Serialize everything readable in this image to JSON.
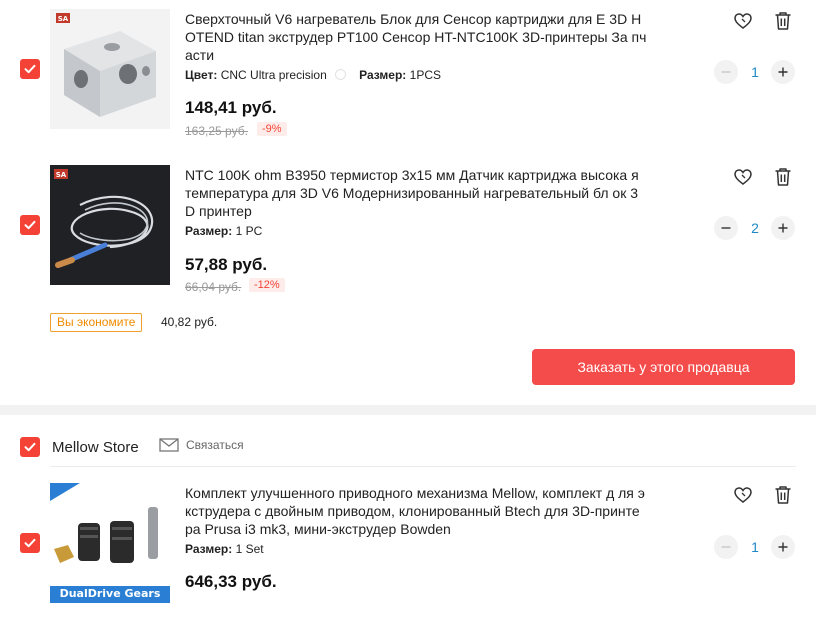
{
  "items": [
    {
      "title": "Сверхточный V6 нагреватель Блок для Сенсор картриджи для E 3D HOTEND titan экструдер PT100 Сенсор HT-NTC100K 3D-принтеры За пчасти",
      "prop1_key": "Цвет:",
      "prop1_val": "CNC Ultra precision",
      "prop2_key": "Размер:",
      "prop2_val": "1PCS",
      "price": "148,41 руб.",
      "old_price": "163,25 руб.",
      "discount": "-9%",
      "qty": "1"
    },
    {
      "title": "NTC 100K ohm B3950 термистор 3x15 мм Датчик картриджа высока я температура для 3D V6 Модернизированный нагревательный бл ок 3D принтер",
      "prop1_key": "Размер:",
      "prop1_val": "1 PC",
      "price": "57,88 руб.",
      "old_price": "66,04 руб.",
      "discount": "-12%",
      "qty": "2"
    },
    {
      "title": "Комплект улучшенного приводного механизма Mellow, комплект д ля экструдера с двойным приводом, клонированный Btech для 3D-принтера Prusa i3 mk3, мини-экструдер Bowden",
      "prop1_key": "Размер:",
      "prop1_val": "1 Set",
      "price": "646,33 руб.",
      "qty": "1",
      "image_caption": "DualDrive Gears"
    }
  ],
  "seller_summary": {
    "save_label": "Вы экономите",
    "save_value": "40,82 руб.",
    "order_button": "Заказать у этого продавца"
  },
  "store": {
    "name": "Mellow Store",
    "contact_label": "Связаться"
  },
  "colors": {
    "accent": "#f44336",
    "order_button": "#f44b4b",
    "qty_value": "#1e88c8",
    "save_badge": "#f08c00"
  },
  "icons": {
    "checkbox": "check-icon",
    "wishlist": "heart-icon",
    "delete": "trash-icon",
    "decrement": "minus-icon",
    "increment": "plus-icon",
    "contact": "envelope-icon"
  }
}
